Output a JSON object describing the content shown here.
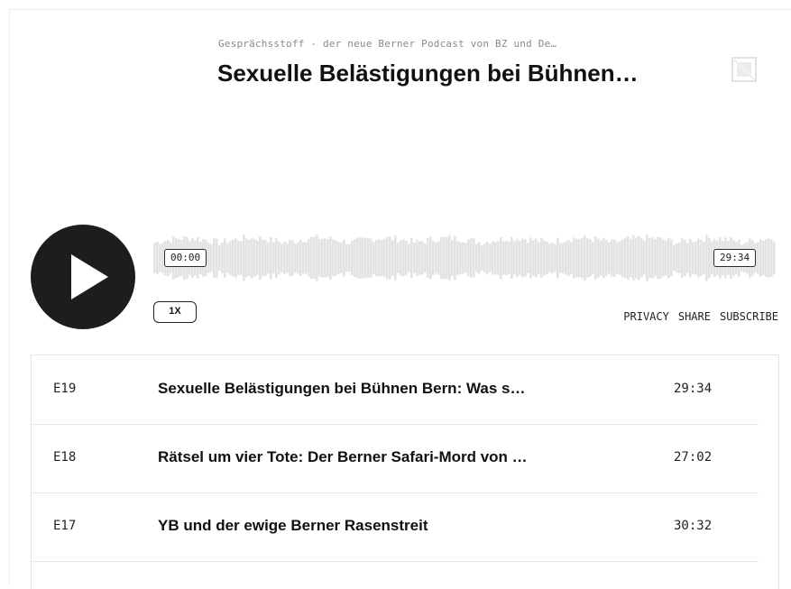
{
  "header": {
    "podcast_name": "Gesprächsstoff - der neue Berner Podcast von BZ und De…",
    "episode_title": "Sexuelle Belästigungen bei Bühnen…",
    "cover_icon": "no-image-icon"
  },
  "player": {
    "play_icon": "play-icon",
    "current_time": "00:00",
    "total_time": "29:34",
    "progress": 0,
    "speed": "1X",
    "colors": {
      "waveform": "#e3e3e3",
      "button": "#1d1d1d"
    }
  },
  "links": {
    "privacy": "PRIVACY",
    "share": "SHARE",
    "subscribe": "SUBSCRIBE"
  },
  "episodes": [
    {
      "number": "E19",
      "title": "Sexuelle Belästigungen bei Bühnen Bern: Was s…",
      "duration": "29:34"
    },
    {
      "number": "E18",
      "title": "Rätsel um vier Tote: Der Berner Safari-Mord von …",
      "duration": "27:02"
    },
    {
      "number": "E17",
      "title": "YB und der ewige Berner Rasenstreit",
      "duration": "30:32"
    }
  ]
}
